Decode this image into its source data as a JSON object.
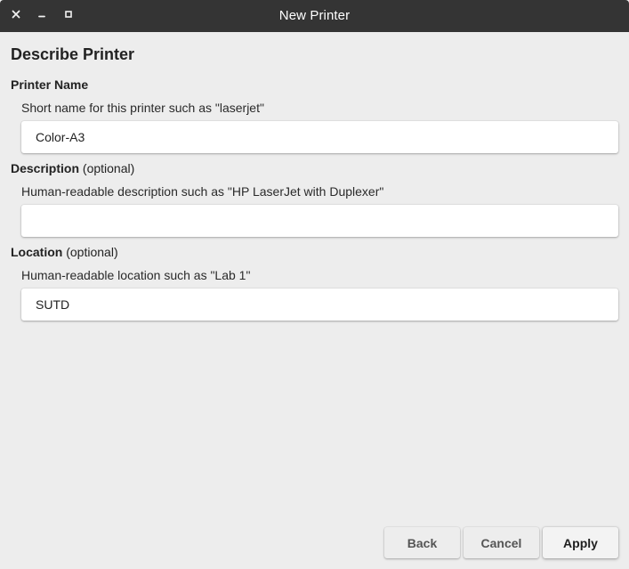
{
  "window": {
    "title": "New Printer"
  },
  "icons": {
    "close": "close-icon",
    "minimize": "minimize-icon",
    "maximize": "maximize-icon"
  },
  "page": {
    "heading": "Describe Printer"
  },
  "fields": {
    "name": {
      "label": "Printer Name",
      "hint": "Short name for this printer such as \"laserjet\"",
      "value": "Color-A3",
      "placeholder": ""
    },
    "description": {
      "label": "Description",
      "label_suffix": "(optional)",
      "hint": "Human-readable description such as \"HP LaserJet with Duplexer\"",
      "value": "",
      "placeholder": ""
    },
    "location": {
      "label": "Location",
      "label_suffix": "(optional)",
      "hint": "Human-readable location such as \"Lab 1\"",
      "value": "SUTD",
      "placeholder": ""
    }
  },
  "buttons": {
    "back": "Back",
    "cancel": "Cancel",
    "apply": "Apply"
  },
  "colors": {
    "titlebar": "#343434",
    "background": "#ededed",
    "field_background": "#ffffff"
  }
}
